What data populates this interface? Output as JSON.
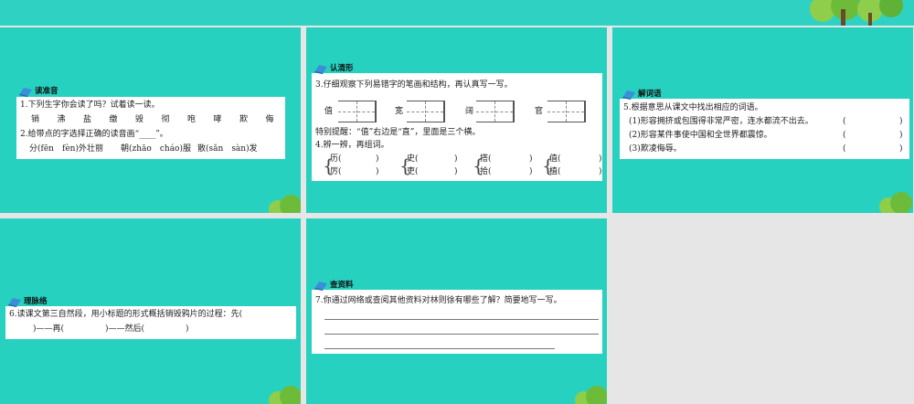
{
  "s1": {
    "heading": "读准音",
    "q1": "1.下列生字你会读了吗？试着读一读。",
    "chars": [
      "销",
      "沸",
      "盐",
      "缴",
      "毁",
      "彻",
      "咆",
      "哮",
      "欺",
      "侮"
    ],
    "q2": "2.给带点的字选择正确的读音画“____”。",
    "items": [
      {
        "before": "分(fēn",
        "mid": "fèn)外壮丽"
      },
      {
        "before": "朝(zhāo",
        "mid": "cháo)服"
      },
      {
        "before": "散(sǎn",
        "mid": "sàn)发"
      }
    ]
  },
  "s2": {
    "heading": "认清形",
    "q3": "3.仔细观察下列易错字的笔画和结构，再认真写一写。",
    "grid_chars": [
      "值",
      "宽",
      "阔",
      "官"
    ],
    "tip": "特别提醒：“值”右边是“直”，里面是三个横。",
    "q4": "4.辨一辨，再组词。",
    "pairs": [
      {
        "top": "历(",
        "bottom": "厉("
      },
      {
        "top": "史(",
        "bottom": "吏("
      },
      {
        "top": "搭(",
        "bottom": "拾("
      },
      {
        "top": "值(",
        "bottom": "植("
      }
    ],
    "close": ")"
  },
  "s3": {
    "heading": "解词语",
    "q5": "5.根据意思从课文中找出相应的词语。",
    "items": [
      "(1)形容拥挤或包围得非常严密，连水都流不出去。",
      "(2)形容某件事使中国和全世界都震惊。",
      "(3)欺凌侮辱。"
    ],
    "open": "(",
    "close": ")"
  },
  "s4": {
    "heading": "理脉络",
    "q6": "6.读课文第三自然段，用小标题的形式概括销毁鸦片的过程：先(",
    "q6b": ")——再(　　　　　)——然后(　　　　　)"
  },
  "s5": {
    "heading": "查资料",
    "q7": "7.你通过网络或查阅其他资料对林则徐有哪些了解？简要地写一写。"
  }
}
